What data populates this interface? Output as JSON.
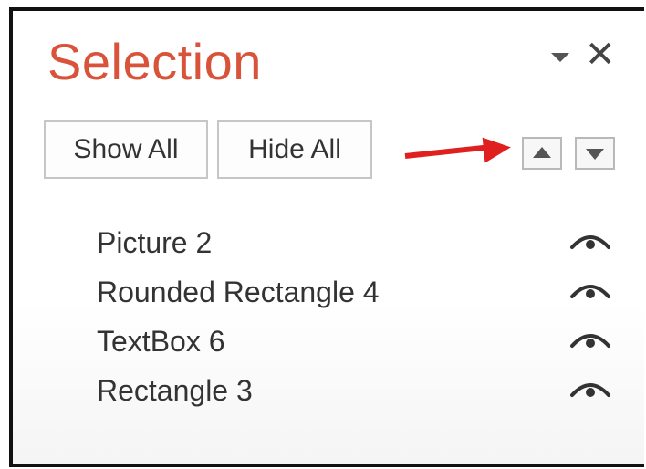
{
  "pane": {
    "title": "Selection",
    "menu_icon": "dropdown-caret-icon",
    "close_icon": "close-icon"
  },
  "toolbar": {
    "show_all_label": "Show All",
    "hide_all_label": "Hide All",
    "bring_forward_icon": "triangle-up-icon",
    "send_backward_icon": "triangle-down-icon"
  },
  "annotation": {
    "arrow_color": "#e01f1f"
  },
  "items": [
    {
      "label": "Picture 2",
      "visibility_icon": "eye-icon"
    },
    {
      "label": "Rounded Rectangle 4",
      "visibility_icon": "eye-icon"
    },
    {
      "label": "TextBox 6",
      "visibility_icon": "eye-icon"
    },
    {
      "label": "Rectangle 3",
      "visibility_icon": "eye-icon"
    }
  ],
  "colors": {
    "title": "#d9533b",
    "text": "#333333",
    "border": "#111111"
  }
}
